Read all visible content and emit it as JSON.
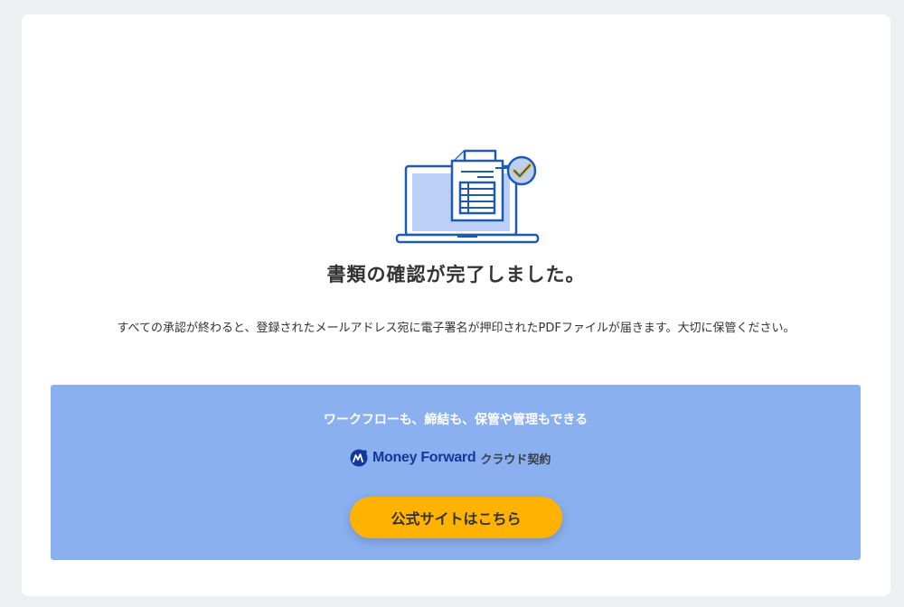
{
  "completion": {
    "title": "書類の確認が完了しました。",
    "description": "すべての承認が終わると、登録されたメールアドレス宛に電子署名が押印されたPDFファイルが届きます。大切に保管ください。"
  },
  "promo": {
    "tagline": "ワークフローも、締結も、保管や管理もできる",
    "logo_wordmark": "Money Forward",
    "logo_product": "クラウド契約",
    "cta_label": "公式サイトはこちら"
  },
  "colors": {
    "page_background": "#eef0f4",
    "promo_background": "#8bb0ef",
    "cta_background": "#ffb300",
    "illustration_blue": "#1f5ab0",
    "illustration_fill": "#bcd0f7",
    "check_yellow": "#f4c21a",
    "brand_navy": "#12389a"
  },
  "icons": {
    "illustration": "laptop-document-check-icon",
    "brand": "money-forward-logo-icon"
  }
}
